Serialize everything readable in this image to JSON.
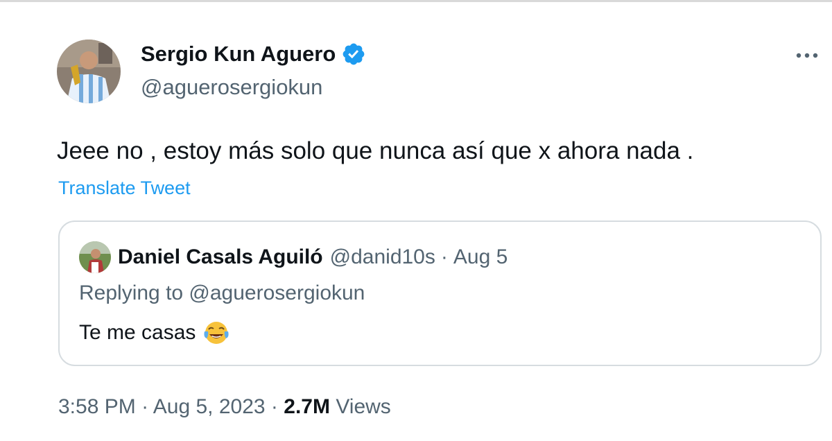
{
  "tweet": {
    "author": {
      "name": "Sergio Kun Aguero",
      "handle": "@aguerosergiokun",
      "verified": true,
      "avatar_icon": "user-avatar-photo"
    },
    "text": "Jeee no , estoy más solo que nunca así que x ahora nada .",
    "translate_label": "Translate Tweet",
    "more_icon": "more-horizontal-icon",
    "quoted": {
      "name": "Daniel Casals Aguiló",
      "handle": "@danid10s",
      "separator": "·",
      "date": "Aug 5",
      "replying_to": "Replying to @aguerosergiokun",
      "text": "Te me casas",
      "emoji": "face-with-tears-of-joy"
    },
    "meta": {
      "time": "3:58 PM",
      "separator": "·",
      "date": "Aug 5, 2023",
      "views_count": "2.7M",
      "views_label": "Views"
    }
  },
  "colors": {
    "text_primary": "#0f1419",
    "text_secondary": "#536471",
    "link": "#1d9bf0",
    "verified": "#1d9bf0",
    "border": "#d6dce0"
  }
}
